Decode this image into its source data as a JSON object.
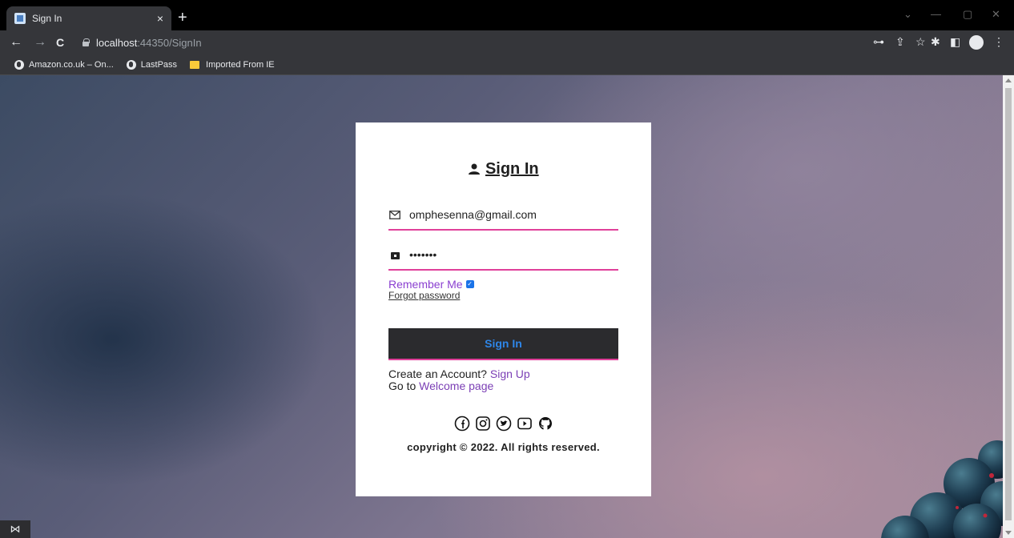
{
  "browser": {
    "tab": {
      "title": "Sign In",
      "close_icon": "×"
    },
    "new_tab_icon": "+",
    "window_controls": {
      "dropdown": "⌄",
      "minimize": "—",
      "restore": "▢",
      "close": "✕"
    },
    "nav": {
      "back": "←",
      "forward": "→",
      "reload": "C"
    },
    "url": {
      "host": "localhost",
      "path": ":44350/SignIn"
    },
    "toolbar_icons": {
      "key": "⊶",
      "share": "⇪",
      "star": "☆",
      "extensions": "✱",
      "sidebar": "◧",
      "menu": "⋮"
    },
    "bookmarks": [
      {
        "label": "Amazon.co.uk – On...",
        "icon": "globe-icon"
      },
      {
        "label": "LastPass",
        "icon": "globe-icon"
      },
      {
        "label": "Imported From IE",
        "icon": "folder-icon"
      }
    ]
  },
  "signin": {
    "title": "Sign In",
    "email_value": "omphesenna@gmail.com",
    "password_value": "•••••••",
    "remember_label": "Remember Me",
    "remember_checked": true,
    "forgot_label": "Forgot password",
    "button_label": "Sign In",
    "create_prefix": "Create an Account? ",
    "create_link": "Sign Up",
    "goto_prefix": "Go to ",
    "goto_link": "Welcome page",
    "social_icons": [
      "facebook-icon",
      "instagram-icon",
      "twitter-icon",
      "youtube-icon",
      "github-icon"
    ],
    "copyright": "copyright © 2022. All rights reserved."
  },
  "taskbar": {
    "vs_icon": "⋈"
  },
  "colors": {
    "accent_underline": "#e0409a",
    "button_bg": "#2b2b2e",
    "button_text": "#2e86e8",
    "link": "#7b3fb5"
  }
}
